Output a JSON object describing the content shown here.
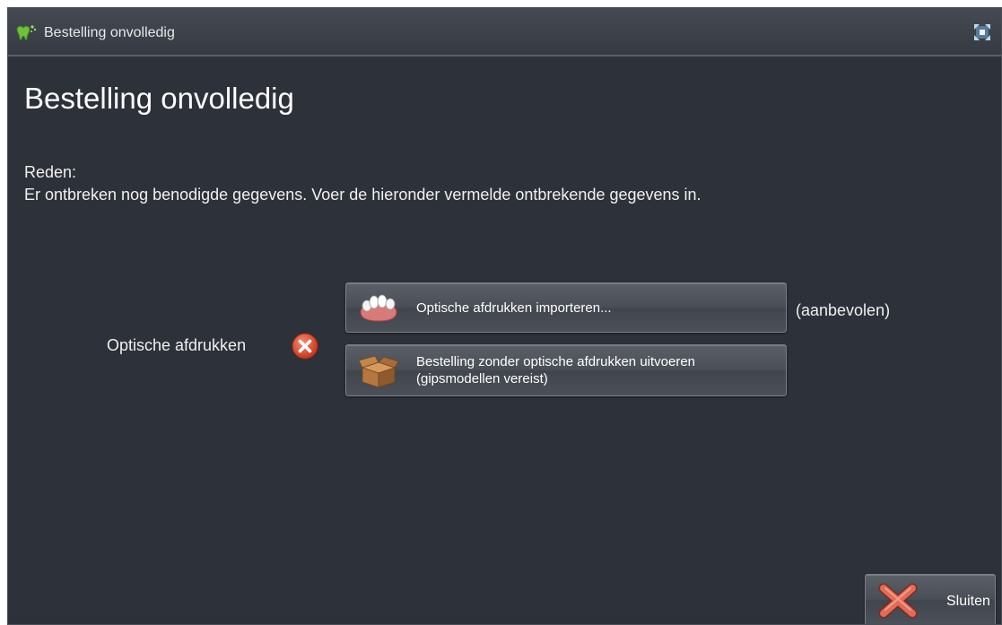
{
  "window": {
    "title": "Bestelling onvolledig",
    "app_icon": "green-tooth-icon",
    "maximize_icon": "maximize-icon"
  },
  "main": {
    "heading": "Bestelling onvolledig",
    "reason_label": "Reden:",
    "reason_text": "Er ontbreken nog benodigde gegevens. Voer de hieronder vermelde ontbrekende gegevens in."
  },
  "item": {
    "label": "Optische afdrukken",
    "status_icon": "error-icon",
    "status_color": "#e0503a",
    "recommended_note": "(aanbevolen)",
    "import_button": {
      "icon": "dental-model-icon",
      "label": "Optische afdrukken importeren..."
    },
    "order_button": {
      "icon": "cardboard-box-icon",
      "line1": "Bestelling zonder optische afdrukken uitvoeren",
      "line2": "(gipsmodellen vereist)"
    }
  },
  "footer": {
    "close_button": {
      "icon": "red-x-icon",
      "label": "Sluiten"
    }
  },
  "colors": {
    "background": "#2d3139",
    "titlebar": "#3d4149",
    "text": "#f0f0f0",
    "accent_green": "#6fbf3a",
    "error_red": "#e0503a"
  }
}
